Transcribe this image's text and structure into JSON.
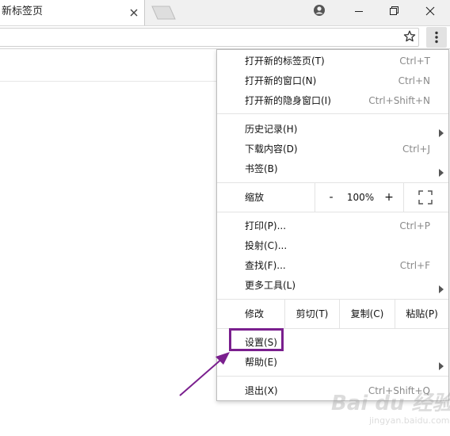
{
  "tab": {
    "title": "新标签页",
    "close_icon": "close-icon",
    "new_tab_icon": "new-tab-icon"
  },
  "window_controls": {
    "profile_icon": "profile-icon",
    "minimize_icon": "minimize-icon",
    "restore_icon": "restore-icon",
    "close_icon": "close-icon"
  },
  "toolbar": {
    "address_value": "",
    "bookmark_icon": "star-icon",
    "menu_icon": "more-vert-icon"
  },
  "menu": {
    "new_tab": {
      "label": "打开新的标签页(T)",
      "shortcut": "Ctrl+T"
    },
    "new_window": {
      "label": "打开新的窗口(N)",
      "shortcut": "Ctrl+N"
    },
    "new_incognito": {
      "label": "打开新的隐身窗口(I)",
      "shortcut": "Ctrl+Shift+N"
    },
    "history": {
      "label": "历史记录(H)"
    },
    "downloads": {
      "label": "下载内容(D)",
      "shortcut": "Ctrl+J"
    },
    "bookmarks": {
      "label": "书签(B)"
    },
    "zoom": {
      "label": "缩放",
      "minus": "-",
      "value": "100%",
      "plus": "+"
    },
    "print": {
      "label": "打印(P)...",
      "shortcut": "Ctrl+P"
    },
    "cast": {
      "label": "投射(C)..."
    },
    "find": {
      "label": "查找(F)...",
      "shortcut": "Ctrl+F"
    },
    "more_tools": {
      "label": "更多工具(L)"
    },
    "edit": {
      "label": "修改",
      "cut": "剪切(T)",
      "copy": "复制(C)",
      "paste": "粘贴(P)"
    },
    "settings": {
      "label": "设置(S)"
    },
    "help": {
      "label": "帮助(E)"
    },
    "exit": {
      "label": "退出(X)",
      "shortcut": "Ctrl+Shift+Q"
    }
  },
  "annotation": {
    "highlight_color": "#7a1f8e"
  },
  "watermark": {
    "main": "Bai du 经验",
    "sub": "jingyan.baidu.com"
  },
  "colors": {
    "tabstrip_bg": "#f0f0f0",
    "menu_border": "#bdbdbd",
    "shortcut_text": "#8a8a8a"
  }
}
